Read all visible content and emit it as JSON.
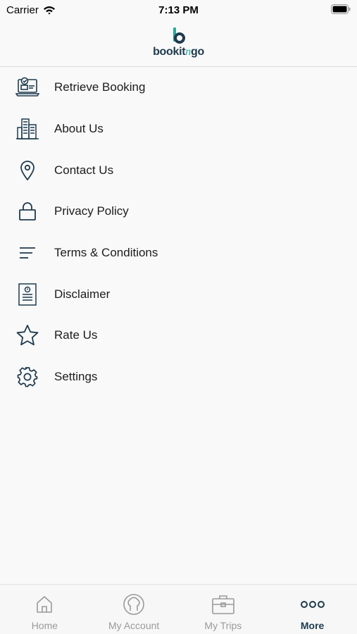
{
  "status_bar": {
    "carrier": "Carrier",
    "time": "7:13 PM"
  },
  "header": {
    "logo_text_main": "bookit",
    "logo_text_accent": "n",
    "logo_text_end": "go"
  },
  "menu": {
    "items": [
      {
        "label": "Retrieve Booking",
        "icon": "ticket-laptop-icon"
      },
      {
        "label": "About Us",
        "icon": "building-icon"
      },
      {
        "label": "Contact Us",
        "icon": "location-pin-icon"
      },
      {
        "label": "Privacy Policy",
        "icon": "lock-icon"
      },
      {
        "label": "Terms & Conditions",
        "icon": "lines-icon"
      },
      {
        "label": "Disclaimer",
        "icon": "document-icon"
      },
      {
        "label": "Rate Us",
        "icon": "star-icon"
      },
      {
        "label": "Settings",
        "icon": "gear-icon"
      }
    ]
  },
  "tab_bar": {
    "tabs": [
      {
        "label": "Home",
        "icon": "home-icon",
        "active": false
      },
      {
        "label": "My Account",
        "icon": "account-icon",
        "active": false
      },
      {
        "label": "My Trips",
        "icon": "briefcase-icon",
        "active": false
      },
      {
        "label": "More",
        "icon": "more-icon",
        "active": true
      }
    ]
  },
  "colors": {
    "brand_dark": "#1e3a4e",
    "brand_accent": "#2aa898",
    "inactive_tab": "#9a9a9a"
  }
}
